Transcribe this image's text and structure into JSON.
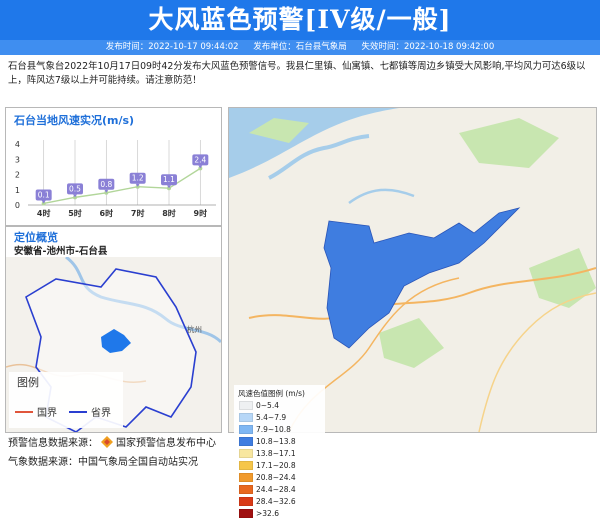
{
  "header": {
    "title": "大风蓝色预警[IV级/一般]",
    "publish_time": "发布时间：2022-10-17 09:44:02",
    "publisher": "发布单位：石台县气象局",
    "expire_time": "失效时间：2022-10-18 09:42:00"
  },
  "description": "石台县气象台2022年10月17日09时42分发布大风蓝色预警信号。我县仁里镇、仙寓镇、七都镇等周边乡镇受大风影响,平均风力可达6级以上，阵风达7级以上并可能持续。请注意防范！",
  "wind_chart": {
    "title": "石台当地风速实况(m/s)",
    "yticks": [
      "0",
      "1",
      "2",
      "3",
      "4"
    ],
    "chart_data": {
      "type": "line",
      "title": "石台当地风速实况(m/s)",
      "categories": [
        "4时",
        "5时",
        "6时",
        "7时",
        "8时",
        "9时"
      ],
      "values": [
        0.1,
        0.5,
        0.8,
        1.2,
        1.1,
        2.4
      ],
      "value_labels": [
        "0.1",
        "0.5",
        "0.8",
        "1.2",
        "1.1",
        "2.4"
      ],
      "ylim": [
        0,
        4
      ],
      "line_color": "#b2d69a",
      "label_color": "#8a80d6"
    }
  },
  "location": {
    "title": "定位概览",
    "region": "安徽省-池州市-石台县",
    "legend_title": "图例",
    "legend_items": [
      {
        "label": "国界",
        "color": "#e0553b"
      },
      {
        "label": "省界",
        "color": "#2a3fd0"
      }
    ],
    "city_label": "杭州"
  },
  "wind_legend": {
    "title": "风速色值图例 (m/s)",
    "items": [
      {
        "label": "0~5.4",
        "color": "#eef0f2"
      },
      {
        "label": "5.4~7.9",
        "color": "#b7d7f7"
      },
      {
        "label": "7.9~10.8",
        "color": "#7fb7f3"
      },
      {
        "label": "10.8~13.8",
        "color": "#3f7de0"
      },
      {
        "label": "13.8~17.1",
        "color": "#f8e7a0"
      },
      {
        "label": "17.1~20.8",
        "color": "#f6c64a"
      },
      {
        "label": "20.8~24.4",
        "color": "#f19a2c"
      },
      {
        "label": "24.4~28.4",
        "color": "#e8681f"
      },
      {
        "label": "28.4~32.6",
        "color": "#d93a17"
      },
      {
        "label": ">32.6",
        "color": "#a01010"
      }
    ]
  },
  "footer": {
    "source1_label": "预警信息数据来源：",
    "source1_value": "国家预警信息发布中心",
    "source2": "气象数据来源：中国气象局全国自动站实况"
  }
}
